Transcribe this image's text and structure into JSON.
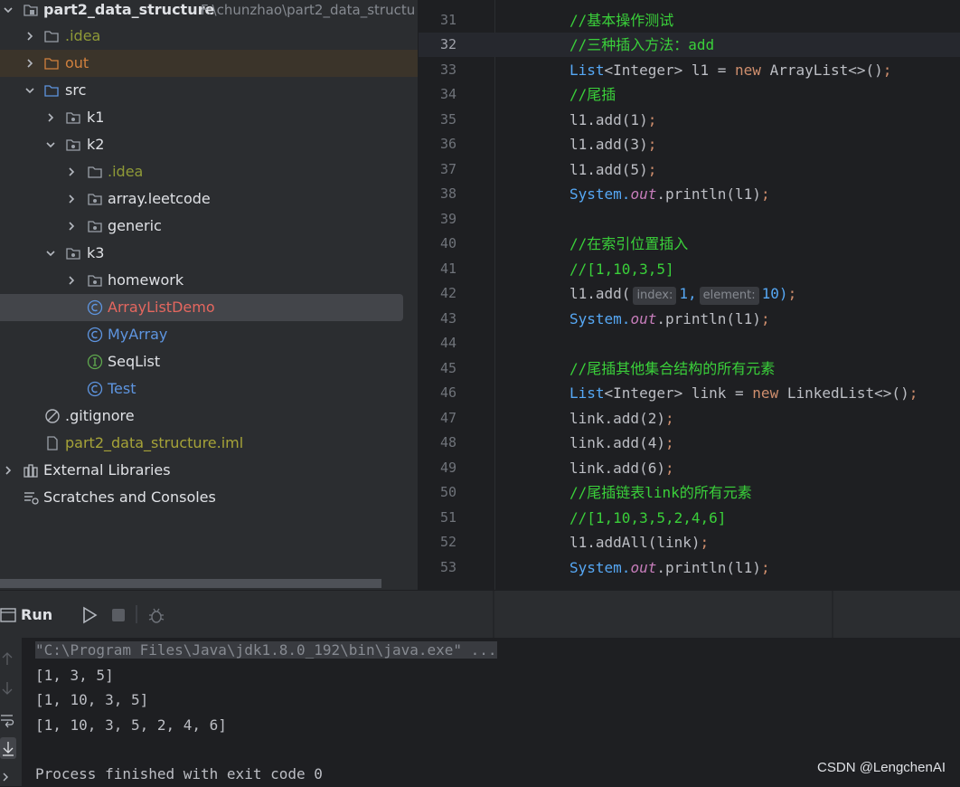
{
  "project_tree": {
    "root_label": "part2_data_structure",
    "root_path": "F:\\chunzhao\\part2_data_structu",
    "items": {
      "idea": ".idea",
      "out": "out",
      "src": "src",
      "k1": "k1",
      "k2": "k2",
      "k2_idea": ".idea",
      "array_leetcode": "array.leetcode",
      "generic": "generic",
      "k3": "k3",
      "homework": "homework",
      "arraylistdemo": "ArrayListDemo",
      "myarray": "MyArray",
      "seqlist": "SeqList",
      "test": "Test",
      "gitignore": ".gitignore",
      "iml": "part2_data_structure.iml",
      "external_libraries": "External Libraries",
      "scratches": "Scratches and Consoles"
    }
  },
  "editor": {
    "current_line": 32,
    "line_numbers": [
      "31",
      "32",
      "33",
      "34",
      "35",
      "36",
      "37",
      "38",
      "39",
      "40",
      "41",
      "42",
      "43",
      "44",
      "45",
      "46",
      "47",
      "48",
      "49",
      "50",
      "51",
      "52",
      "53"
    ],
    "code": {
      "l31": "//基本操作测试",
      "l32": "//三种插入方法：add",
      "l33_type": "List",
      "l33_generic": "<Integer>",
      "l33_var": " l1 = ",
      "l33_new": "new",
      "l33_rest": " ArrayList<>()",
      "l34": "//尾插",
      "l35": "l1.add(1)",
      "l36": "l1.add(3)",
      "l37": "l1.add(5)",
      "l38_sys": "System.",
      "l38_out": "out",
      "l38_rest": ".println(l1)",
      "l40": "//在索引位置插入",
      "l41": "//[1,10,3,5]",
      "l42_start": "l1.add(",
      "l42_hint1": "index:",
      "l42_v1": "1,",
      "l42_hint2": "element:",
      "l42_v2": "10)",
      "l45": "//尾插其他集合结构的所有元素",
      "l46_type": "List",
      "l46_generic": "<Integer>",
      "l46_var": " link = ",
      "l46_new": "new",
      "l46_rest": " LinkedList<>()",
      "l47": "link.add(2)",
      "l48": "link.add(4)",
      "l49": "link.add(6)",
      "l50": "//尾插链表link的所有元素",
      "l51": "//[1,10,3,5,2,4,6]",
      "l52": "l1.addAll(link)",
      "semicolon": ";"
    }
  },
  "run_panel": {
    "title": "Run",
    "command": "\"C:\\Program Files\\Java\\jdk1.8.0_192\\bin\\java.exe\" ...",
    "output": [
      "[1, 3, 5]",
      "[1, 10, 3, 5]",
      "[1, 10, 3, 5, 2, 4, 6]",
      "",
      "Process finished with exit code 0"
    ]
  },
  "watermark": "CSDN @LengchenAI",
  "colors": {
    "comment": "#3ad03a",
    "keyword": "#cf8e6d",
    "type": "#56a8f5",
    "field": "#c77dbb",
    "class_icon": "#5e95e0",
    "interface_icon": "#5fa84e"
  }
}
